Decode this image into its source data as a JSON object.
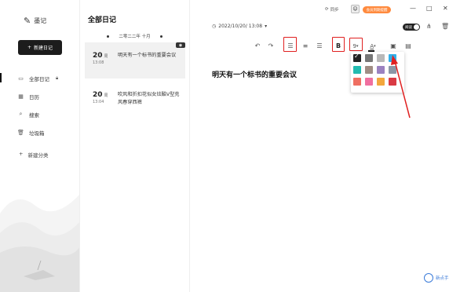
{
  "app": {
    "name": "墨记"
  },
  "sidebar": {
    "new_button": "新建日记",
    "items": [
      {
        "label": "全部日记",
        "active": true
      },
      {
        "label": "日历"
      },
      {
        "label": "搜索"
      },
      {
        "label": "垃圾箱"
      }
    ],
    "new_category": "新建分类"
  },
  "list": {
    "title": "全部日记",
    "month": "二零二二年 十月",
    "entries": [
      {
        "day": "20",
        "weekday": "周",
        "time": "13:08",
        "text": "明天有一个标书的重要会议",
        "selected": true
      },
      {
        "day": "20",
        "weekday": "周",
        "time": "13:04",
        "text": "吹风和折扣花似女炫酷V型充风春穿西裤"
      }
    ]
  },
  "topbar": {
    "sync": "同步",
    "vip": "会员到期提醒"
  },
  "editor": {
    "date": "2022/10/20/ 13:08",
    "read_mode": "阅读",
    "font_size": "9",
    "title": "明天有一个标书的重要会议"
  },
  "palette": {
    "colors": [
      "#222222",
      "#777777",
      "#b8b8b8",
      "#2fb0ea",
      "#22bbb0",
      "#a08d84",
      "#9b82c0",
      "#8c97a6",
      "#ef6f62",
      "#f06fa0",
      "#f3a73d",
      "#d93a44"
    ],
    "selected_index": 0,
    "highlight_index": 3
  },
  "watermark": {
    "text": "新点手"
  },
  "colors": {
    "accent_red": "#e02020",
    "vip_orange": "#ff8a3d",
    "dark": "#1c1c1c"
  }
}
